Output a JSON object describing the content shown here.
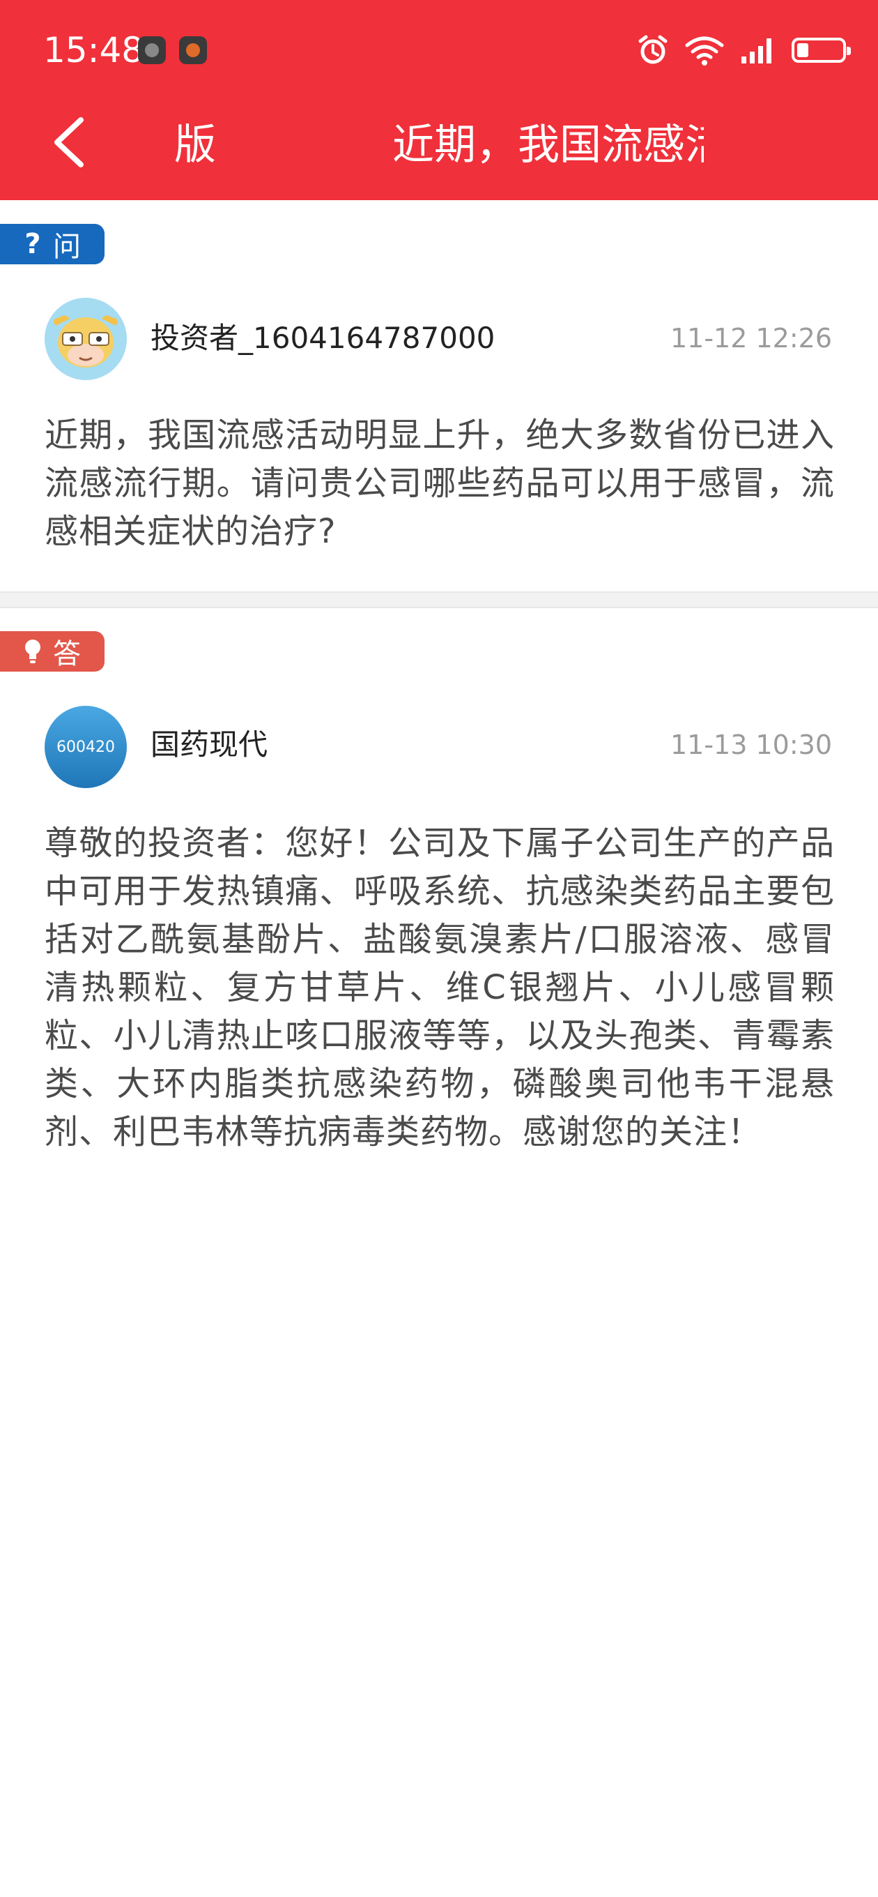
{
  "status_bar": {
    "time": "15:48"
  },
  "nav": {
    "left_label": "版",
    "title": "近期，我国流感活"
  },
  "question": {
    "tag_label": "问",
    "user_name": "投资者_1604164787000",
    "timestamp": "11-12 12:26",
    "text": "近期，我国流感活动明显上升，绝大多数省份已进入流感流行期。请问贵公司哪些药品可以用于感冒，流感相关症状的治疗?"
  },
  "answer": {
    "tag_label": "答",
    "avatar_code": "600420",
    "company_name": "国药现代",
    "timestamp": "11-13 10:30",
    "text": "尊敬的投资者：您好！公司及下属子公司生产的产品中可用于发热镇痛、呼吸系统、抗感染类药品主要包括对乙酰氨基酚片、盐酸氨溴素片/口服溶液、感冒清热颗粒、复方甘草片、维C银翘片、小儿感冒颗粒、小儿清热止咳口服液等等，以及头孢类、青霉素类、大环内脂类抗感染药物，磷酸奥司他韦干混悬剂、利巴韦林等抗病毒类药物。感谢您的关注！"
  },
  "colors": {
    "header": "#f0303a",
    "question_tag": "#1669bd",
    "answer_tag": "#e2574a"
  }
}
